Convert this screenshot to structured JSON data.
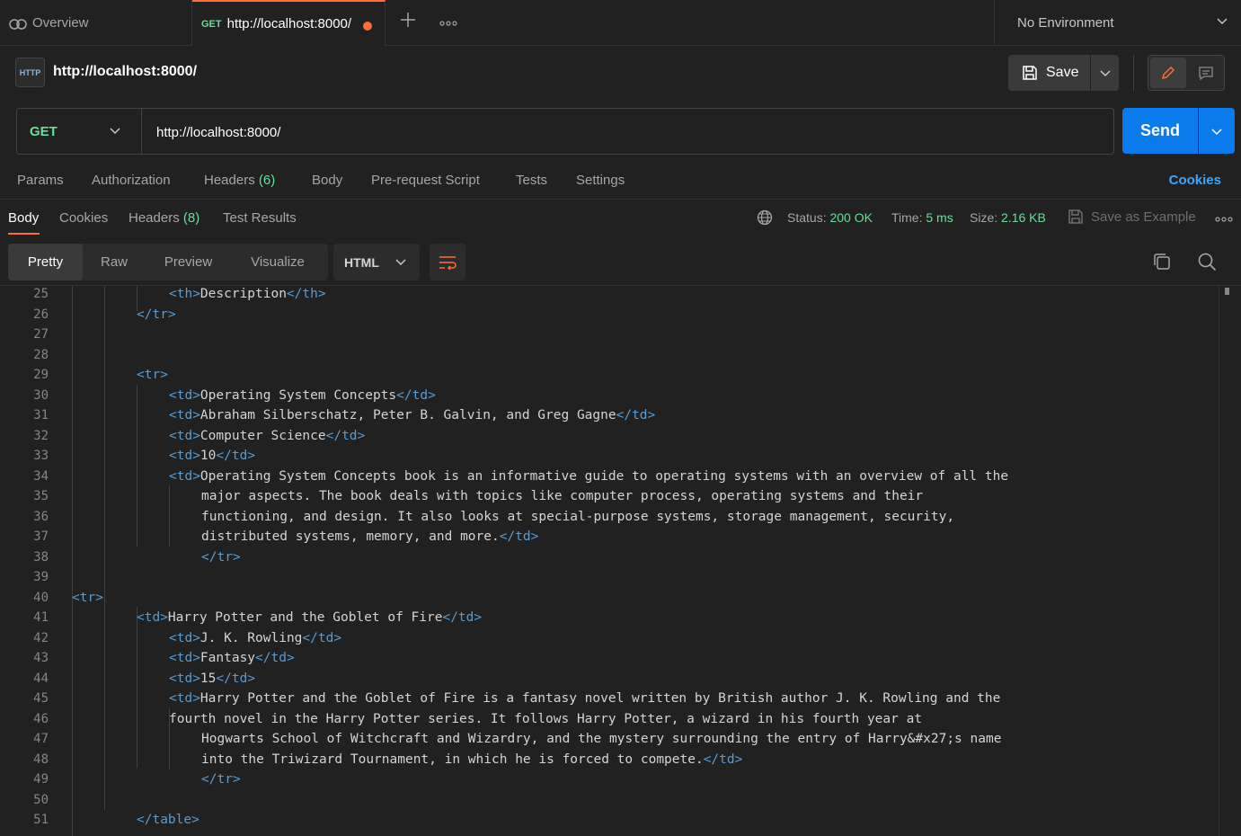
{
  "tabs": {
    "overview_label": "Overview",
    "active_method": "GET",
    "active_url": "http://localhost:8000/"
  },
  "environment": {
    "label": "No Environment"
  },
  "request": {
    "title": "http://localhost:8000/",
    "save_label": "Save",
    "method": "GET",
    "url": "http://localhost:8000/",
    "send_label": "Send"
  },
  "request_tabs": {
    "params": "Params",
    "authorization": "Authorization",
    "headers": "Headers",
    "headers_count": "(6)",
    "body": "Body",
    "prerequest": "Pre-request Script",
    "tests": "Tests",
    "settings": "Settings",
    "cookies": "Cookies"
  },
  "response_tabs": {
    "body": "Body",
    "cookies": "Cookies",
    "headers": "Headers",
    "headers_count": "(8)",
    "test_results": "Test Results"
  },
  "response_meta": {
    "status_label": "Status:",
    "status_value": "200 OK",
    "time_label": "Time:",
    "time_value": "5 ms",
    "size_label": "Size:",
    "size_value": "2.16 KB",
    "save_example": "Save as Example"
  },
  "view_modes": {
    "pretty": "Pretty",
    "raw": "Raw",
    "preview": "Preview",
    "visualize": "Visualize"
  },
  "format": "HTML",
  "colors": {
    "accent_orange": "#ff6c37",
    "send_blue": "#097bed",
    "method_green": "#6bdd9a",
    "tag_blue": "#569cd6",
    "link_blue": "#3ea6ff"
  },
  "icons": {
    "overview": "overview-icon",
    "plus": "plus-icon",
    "more": "more-icon",
    "chevron": "chevron-down-icon",
    "http": "http-icon",
    "save": "save-icon",
    "edit": "pencil-icon",
    "comment": "comment-icon",
    "globe": "globe-icon",
    "wrap": "wrap-lines-icon",
    "copy": "copy-icon",
    "search": "search-icon"
  },
  "code_lines": [
    {
      "n": "25",
      "parts": [
        [
          "t",
          "<th>"
        ],
        [
          "x",
          "Description"
        ],
        [
          "t",
          "</th>"
        ]
      ]
    },
    {
      "n": "26",
      "parts": [
        [
          "t",
          "</tr>"
        ]
      ]
    },
    {
      "n": "27",
      "parts": []
    },
    {
      "n": "28",
      "parts": []
    },
    {
      "n": "29",
      "parts": [
        [
          "t",
          "<tr>"
        ]
      ]
    },
    {
      "n": "30",
      "parts": [
        [
          "t",
          "<td>"
        ],
        [
          "x",
          "Operating System Concepts"
        ],
        [
          "t",
          "</td>"
        ]
      ]
    },
    {
      "n": "31",
      "parts": [
        [
          "t",
          "<td>"
        ],
        [
          "x",
          "Abraham Silberschatz, Peter B. Galvin, and Greg Gagne"
        ],
        [
          "t",
          "</td>"
        ]
      ]
    },
    {
      "n": "32",
      "parts": [
        [
          "t",
          "<td>"
        ],
        [
          "x",
          "Computer Science"
        ],
        [
          "t",
          "</td>"
        ]
      ]
    },
    {
      "n": "33",
      "parts": [
        [
          "t",
          "<td>"
        ],
        [
          "x",
          "10"
        ],
        [
          "t",
          "</td>"
        ]
      ]
    },
    {
      "n": "34",
      "parts": [
        [
          "t",
          "<td>"
        ],
        [
          "x",
          "Operating System Concepts book is an informative guide to operating systems with an overview of all the"
        ]
      ]
    },
    {
      "n": "35",
      "parts": [
        [
          "x",
          "major aspects. The book deals with topics like computer process, operating systems and their"
        ]
      ]
    },
    {
      "n": "36",
      "parts": [
        [
          "x",
          "functioning, and design. It also looks at special-purpose systems, storage management, security,"
        ]
      ]
    },
    {
      "n": "37",
      "parts": [
        [
          "x",
          "distributed systems, memory, and more."
        ],
        [
          "t",
          "</td>"
        ]
      ]
    },
    {
      "n": "38",
      "parts": [
        [
          "t",
          "</tr>"
        ]
      ]
    },
    {
      "n": "39",
      "parts": []
    },
    {
      "n": "40",
      "parts": [
        [
          "t",
          "<tr>"
        ]
      ]
    },
    {
      "n": "41",
      "parts": [
        [
          "t",
          "<td>"
        ],
        [
          "x",
          "Harry Potter and the Goblet of Fire"
        ],
        [
          "t",
          "</td>"
        ]
      ]
    },
    {
      "n": "42",
      "parts": [
        [
          "t",
          "<td>"
        ],
        [
          "x",
          "J. K. Rowling"
        ],
        [
          "t",
          "</td>"
        ]
      ]
    },
    {
      "n": "43",
      "parts": [
        [
          "t",
          "<td>"
        ],
        [
          "x",
          "Fantasy"
        ],
        [
          "t",
          "</td>"
        ]
      ]
    },
    {
      "n": "44",
      "parts": [
        [
          "t",
          "<td>"
        ],
        [
          "x",
          "15"
        ],
        [
          "t",
          "</td>"
        ]
      ]
    },
    {
      "n": "45",
      "parts": [
        [
          "t",
          "<td>"
        ],
        [
          "x",
          "Harry Potter and the Goblet of Fire is a fantasy novel written by British author J. K. Rowling and the"
        ]
      ]
    },
    {
      "n": "46",
      "parts": [
        [
          "x",
          "fourth novel in the Harry Potter series. It follows Harry Potter, a wizard in his fourth year at"
        ]
      ]
    },
    {
      "n": "47",
      "parts": [
        [
          "x",
          "Hogwarts School of Witchcraft and Wizardry, and the mystery surrounding the entry of Harry&#x27;s name"
        ]
      ]
    },
    {
      "n": "48",
      "parts": [
        [
          "x",
          "into the Triwizard Tournament, in which he is forced to compete."
        ],
        [
          "t",
          "</td>"
        ]
      ]
    },
    {
      "n": "49",
      "parts": [
        [
          "t",
          "</tr>"
        ]
      ]
    },
    {
      "n": "50",
      "parts": []
    },
    {
      "n": "51",
      "parts": [
        [
          "t",
          "</table>"
        ]
      ]
    }
  ]
}
